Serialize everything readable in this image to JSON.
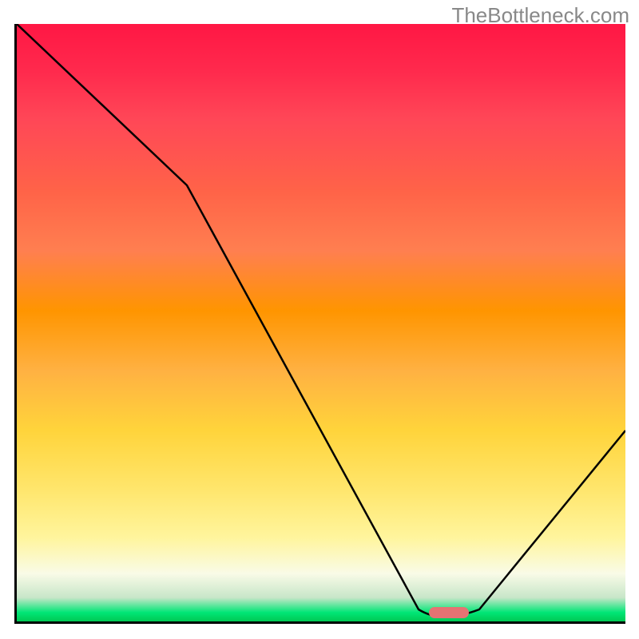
{
  "watermark": "TheBottleneck.com",
  "chart_data": {
    "type": "line",
    "title": "",
    "xlabel": "",
    "ylabel": "",
    "xlim": [
      0,
      100
    ],
    "ylim": [
      0,
      100
    ],
    "marker": {
      "x_pct": 71,
      "y_pct": 99
    },
    "curve_points": [
      {
        "x": 0,
        "y": 100
      },
      {
        "x": 28,
        "y": 73
      },
      {
        "x": 66,
        "y": 2
      },
      {
        "x": 68,
        "y": 0.8
      },
      {
        "x": 74,
        "y": 0.8
      },
      {
        "x": 76,
        "y": 2
      },
      {
        "x": 100,
        "y": 32
      }
    ],
    "gradient": {
      "stops": [
        {
          "pos": 0,
          "color": "#ff1744"
        },
        {
          "pos": 8,
          "color": "#ff2a4d"
        },
        {
          "pos": 16,
          "color": "#ff4757"
        },
        {
          "pos": 28,
          "color": "#ff6348"
        },
        {
          "pos": 38,
          "color": "#ff7f50"
        },
        {
          "pos": 48,
          "color": "#ff9500"
        },
        {
          "pos": 58,
          "color": "#ffb142"
        },
        {
          "pos": 68,
          "color": "#ffd43b"
        },
        {
          "pos": 78,
          "color": "#ffe66d"
        },
        {
          "pos": 86,
          "color": "#fff59d"
        },
        {
          "pos": 92,
          "color": "#f9fbe7"
        },
        {
          "pos": 96,
          "color": "#c8e6c9"
        },
        {
          "pos": 98.5,
          "color": "#00e676"
        },
        {
          "pos": 100,
          "color": "#00c853"
        }
      ]
    }
  }
}
